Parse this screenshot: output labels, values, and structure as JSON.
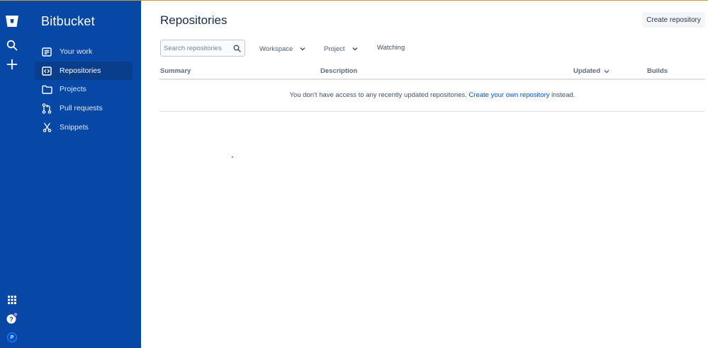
{
  "app": {
    "name": "Bitbucket"
  },
  "rail": {
    "avatar_initial": "P"
  },
  "sidebar": {
    "items": [
      {
        "label": "Your work",
        "icon": "your-work-icon"
      },
      {
        "label": "Repositories",
        "icon": "repositories-icon",
        "active": true
      },
      {
        "label": "Projects",
        "icon": "folder-icon"
      },
      {
        "label": "Pull requests",
        "icon": "pull-request-icon"
      },
      {
        "label": "Snippets",
        "icon": "snippets-icon"
      }
    ]
  },
  "header": {
    "title": "Repositories",
    "create_label": "Create repository"
  },
  "filters": {
    "search_placeholder": "Search repositories",
    "workspace_label": "Workspace",
    "project_label": "Project",
    "watching_label": "Watching"
  },
  "table": {
    "columns": [
      "Summary",
      "Description",
      "Updated",
      "Builds"
    ],
    "empty": {
      "text_before": "You don't have access to any recently updated repositories.",
      "link_text": "Create your own repository",
      "text_after": "instead."
    }
  },
  "colors": {
    "sidebar": "#0747a6",
    "active_item": "#0a3d8c",
    "link": "#0052cc"
  }
}
